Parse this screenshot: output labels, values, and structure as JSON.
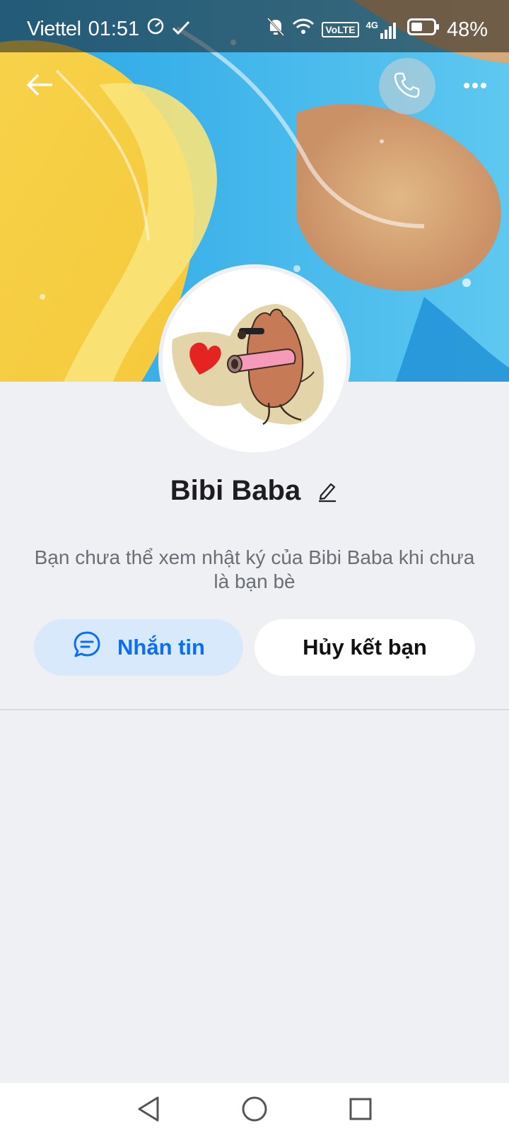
{
  "status_bar": {
    "carrier": "Viettel",
    "time": "01:51",
    "network_badge": "VoLTE",
    "network_type": "4G",
    "battery": "48%"
  },
  "profile": {
    "name": "Bibi Baba",
    "notice": "Bạn chưa thể xem nhật ký của Bibi Baba khi chưa là bạn bè"
  },
  "actions": {
    "message_label": "Nhắn tin",
    "unfriend_label": "Hủy kết bạn"
  },
  "icons": {
    "back": "arrow-left-icon",
    "call": "phone-icon",
    "more": "more-dots-icon",
    "edit": "pencil-icon",
    "message": "chat-bubble-icon",
    "nav_back": "triangle-back-icon",
    "nav_home": "circle-home-icon",
    "nav_recents": "square-recents-icon"
  },
  "colors": {
    "accent": "#0b6ef3",
    "message_button_bg": "#d9e9fc",
    "page_bg": "#eff0f4"
  }
}
